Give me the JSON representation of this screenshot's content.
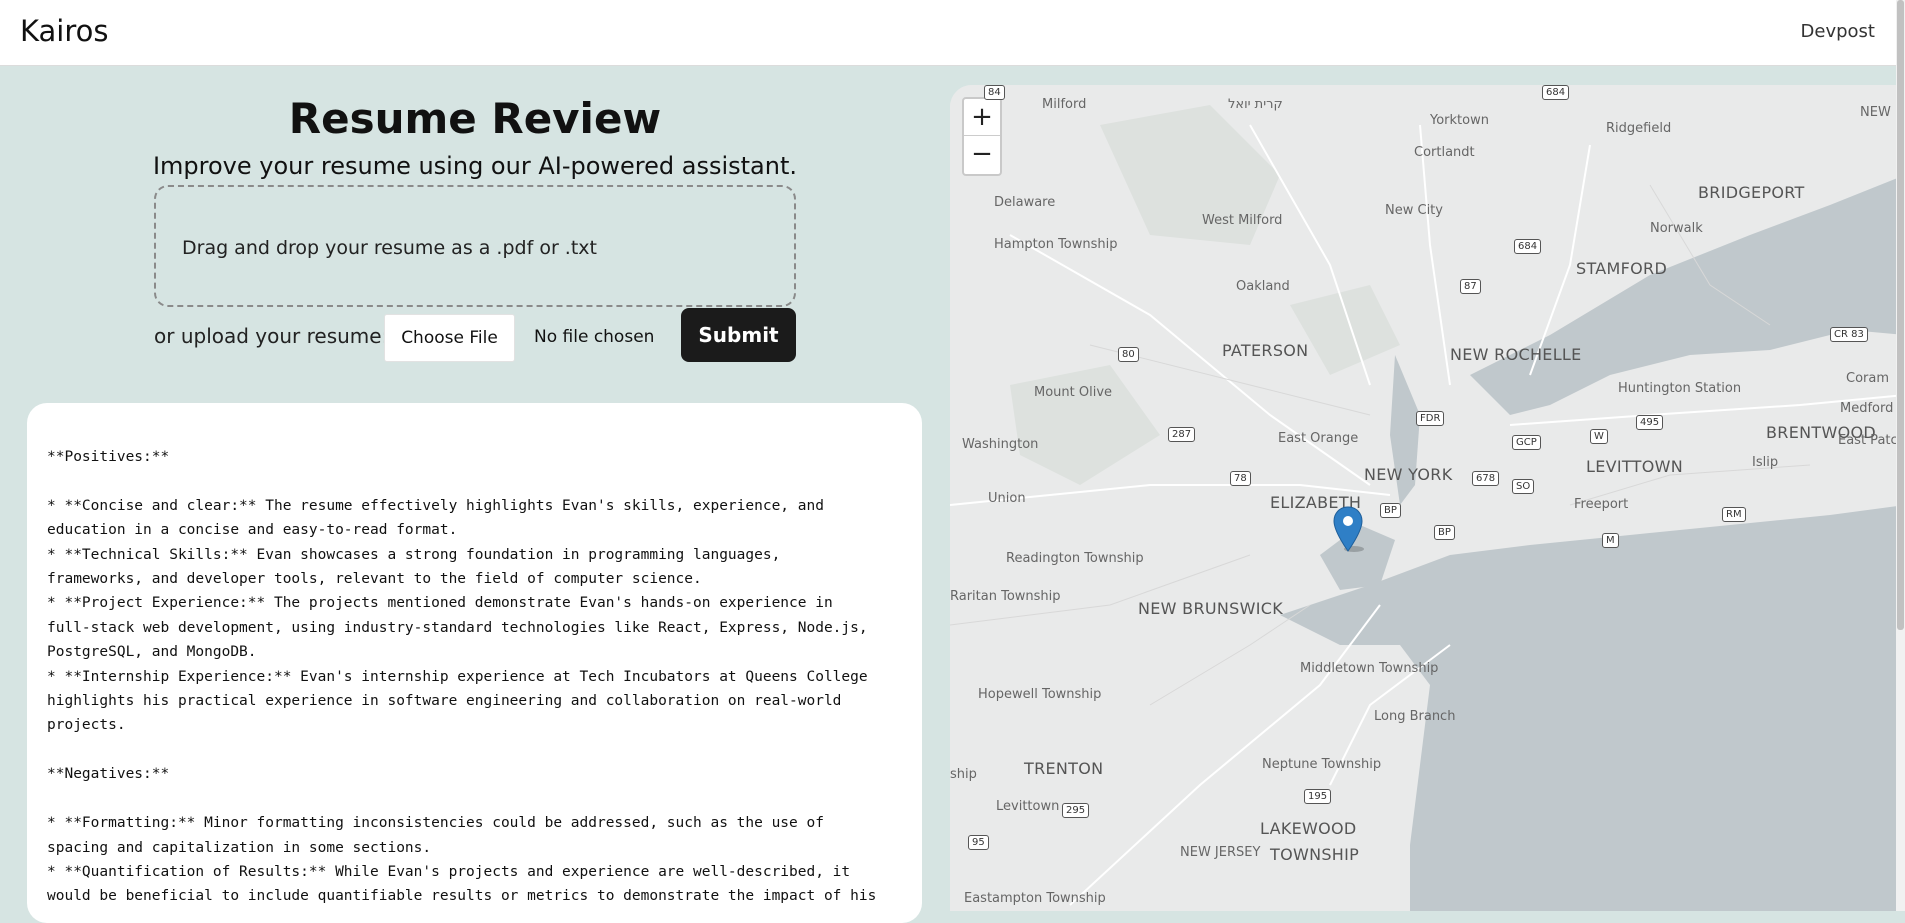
{
  "header": {
    "brand": "Kairos",
    "nav_link": "Devpost"
  },
  "hero": {
    "title": "Resume Review",
    "subtitle": "Improve your resume using our AI-powered assistant."
  },
  "upload": {
    "dropzone_text": "Drag and drop your resume as a .pdf or .txt",
    "label": "or upload your resume:",
    "choose_file": "Choose File",
    "no_file": "No file chosen",
    "submit": "Submit"
  },
  "result": {
    "text": "**Positives:**\n\n* **Concise and clear:** The resume effectively highlights Evan's skills, experience, and\neducation in a concise and easy-to-read format.\n* **Technical Skills:** Evan showcases a strong foundation in programming languages,\nframeworks, and developer tools, relevant to the field of computer science.\n* **Project Experience:** The projects mentioned demonstrate Evan's hands-on experience in\nfull-stack web development, using industry-standard technologies like React, Express, Node.js,\nPostgreSQL, and MongoDB.\n* **Internship Experience:** Evan's internship experience at Tech Incubators at Queens College\nhighlights his practical experience in software engineering and collaboration on real-world\nprojects.\n\n**Negatives:**\n\n* **Formatting:** Minor formatting inconsistencies could be addressed, such as the use of\nspacing and capitalization in some sections.\n* **Quantification of Results:** While Evan's projects and experience are well-described, it\nwould be beneficial to include quantifiable results or metrics to demonstrate the impact of his"
  },
  "map": {
    "zoom_in": "+",
    "zoom_out": "−",
    "colors": {
      "land": "#e9eaea",
      "water": "#c0c8cc",
      "parks": "#d7dcd9",
      "roads": "#ffffff"
    },
    "places": {
      "milford": "Milford",
      "kiryas_joel": "קרית יואל",
      "yorktown": "Yorktown",
      "ridgefield": "Ridgefield",
      "new_h": "NEW H",
      "cortlandt": "Cortlandt",
      "bridgeport": "BRIDGEPORT",
      "delaware": "Delaware",
      "west_milford": "West Milford",
      "new_city": "New City",
      "norwalk": "Norwalk",
      "hampton_township": "Hampton Township",
      "stamford": "STAMFORD",
      "oakland": "Oakland",
      "paterson": "PATERSON",
      "new_rochelle": "NEW ROCHELLE",
      "huntington_station": "Huntington Station",
      "coram": "Coram",
      "mount_olive": "Mount Olive",
      "medford": "Medford",
      "brentwood": "BRENTWOOD",
      "washington": "Washington",
      "east_orange": "East Orange",
      "new_york": "NEW YORK",
      "levittown": "LEVITTOWN",
      "east_patchogue": "East Patchog",
      "islip": "Islip",
      "union": "Union",
      "elizabeth": "ELIZABETH",
      "freeport": "Freeport",
      "readington_township": "Readington Township",
      "raritan_township": "Raritan Township",
      "new_brunswick": "NEW BRUNSWICK",
      "middletown_township": "Middletown Township",
      "hopewell_township": "Hopewell Township",
      "long_branch": "Long Branch",
      "ship": "ship",
      "trenton": "TRENTON",
      "neptune_township": "Neptune Township",
      "levittown_nj": "Levittown",
      "lakewood": "LAKEWOOD",
      "township": "TOWNSHIP",
      "new_jersey": "NEW JERSEY",
      "eastampton_township": "Eastampton Township"
    },
    "shields": {
      "r84": "84",
      "r684_top": "684",
      "r684": "684",
      "r87": "87",
      "r80": "80",
      "r287": "287",
      "fdr": "FDR",
      "cr83": "CR 83",
      "w": "W",
      "r495": "495",
      "gcp": "GCP",
      "r78": "78",
      "r678": "678",
      "so": "SO",
      "bp1": "BP",
      "bp2": "BP",
      "rm": "RM",
      "m": "M",
      "r195": "195",
      "r295": "295",
      "r95": "95"
    },
    "pin_icon": "map-marker-icon"
  }
}
